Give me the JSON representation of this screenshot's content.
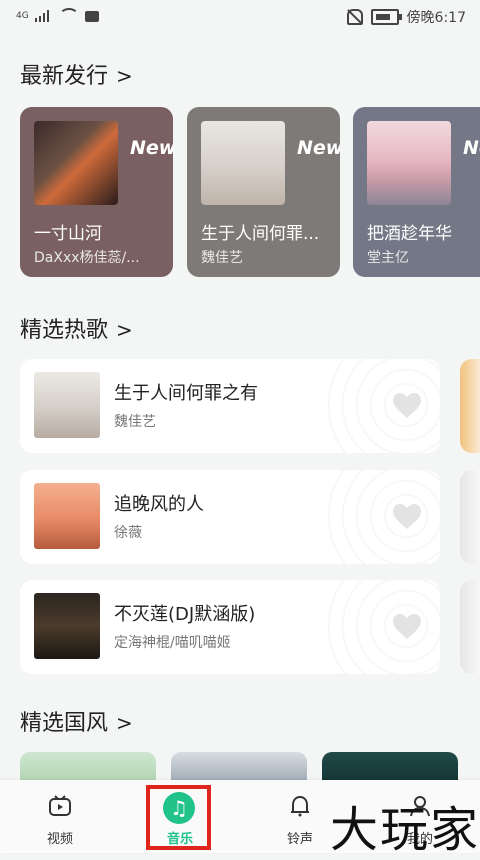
{
  "status": {
    "network": "4G",
    "carrier_time": "傍晚6:17"
  },
  "sections": {
    "new_releases": "最新发行",
    "hot_songs": "精选热歌",
    "guofeng": "精选国风"
  },
  "new_releases": [
    {
      "title": "一寸山河",
      "artist": "DaXxx杨佳蕊/...",
      "badge": "New",
      "color": "#7a6060"
    },
    {
      "title": "生于人间何罪...",
      "artist": "魏佳艺",
      "badge": "New",
      "color": "#7e7a78"
    },
    {
      "title": "把酒趁年华",
      "artist": "堂主亿",
      "badge": "New",
      "color": "#747886"
    }
  ],
  "hot_songs": [
    {
      "title": "生于人间何罪之有",
      "artist": "魏佳艺"
    },
    {
      "title": "追晚风的人",
      "artist": "徐薇"
    },
    {
      "title": "不灭莲(DJ默涵版)",
      "artist": "定海神棍/喵叽喵姬"
    }
  ],
  "nav": {
    "video": "视频",
    "music": "音乐",
    "ringtone": "铃声",
    "mine": "我的"
  },
  "watermark": "大玩家"
}
